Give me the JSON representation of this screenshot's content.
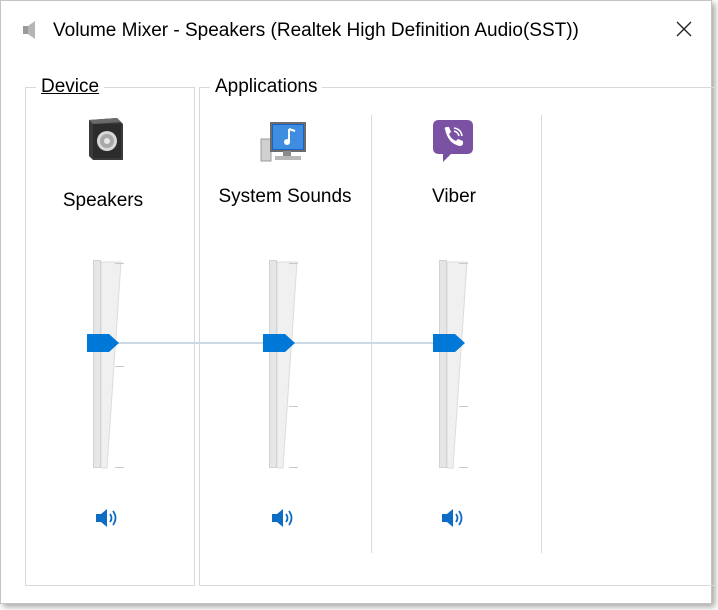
{
  "window": {
    "title": "Volume Mixer - Speakers (Realtek High Definition Audio(SST))"
  },
  "groups": {
    "device_label": "Device",
    "applications_label": "Applications"
  },
  "device": {
    "name": "Speakers",
    "icon": "speaker-box-icon",
    "volume_level": 0.6
  },
  "applications": [
    {
      "name": "System Sounds",
      "icon": "system-sounds-icon",
      "volume_level": 0.6
    },
    {
      "name": "Viber",
      "icon": "viber-icon",
      "volume_level": 0.6
    }
  ],
  "colors": {
    "accent": "#0078d7",
    "viber": "#7b51a3"
  }
}
